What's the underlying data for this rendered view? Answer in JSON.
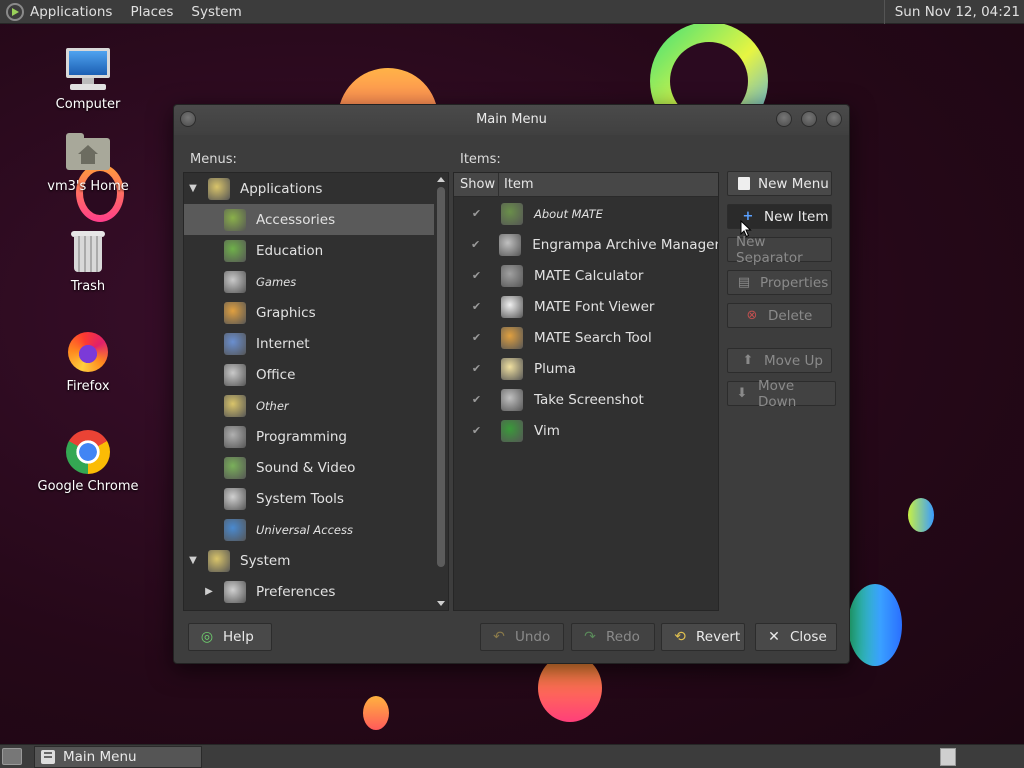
{
  "top_panel": {
    "menus": [
      "Applications",
      "Places",
      "System"
    ],
    "clock": "Sun Nov 12, 04:21"
  },
  "desktop_icons": [
    {
      "label": "Computer",
      "icon": "computer-icon"
    },
    {
      "label": "vm3's Home",
      "icon": "home-folder-icon"
    },
    {
      "label": "Trash",
      "icon": "trash-icon"
    },
    {
      "label": "Firefox",
      "icon": "firefox-icon"
    },
    {
      "label": "Google Chrome",
      "icon": "chrome-icon"
    }
  ],
  "dialog": {
    "title": "Main Menu",
    "menus_label": "Menus:",
    "items_label": "Items:",
    "tree": [
      {
        "label": "Applications",
        "icon": "applications-icon",
        "color": "#d9c46a",
        "level": 0,
        "expander": "▼",
        "italic": false
      },
      {
        "label": "Accessories",
        "icon": "accessories-icon",
        "color": "#8ab04a",
        "level": 1,
        "expander": "",
        "italic": false,
        "selected": true
      },
      {
        "label": "Education",
        "icon": "education-icon",
        "color": "#6fb04a",
        "level": 1,
        "expander": "",
        "italic": false
      },
      {
        "label": "Games",
        "icon": "games-icon",
        "color": "#c9c9c9",
        "level": 1,
        "expander": "",
        "italic": true
      },
      {
        "label": "Graphics",
        "icon": "graphics-icon",
        "color": "#e0a040",
        "level": 1,
        "expander": "",
        "italic": false
      },
      {
        "label": "Internet",
        "icon": "internet-icon",
        "color": "#6a8fd0",
        "level": 1,
        "expander": "",
        "italic": false
      },
      {
        "label": "Office",
        "icon": "office-icon",
        "color": "#c9c9c9",
        "level": 1,
        "expander": "",
        "italic": false
      },
      {
        "label": "Other",
        "icon": "other-icon",
        "color": "#d9c46a",
        "level": 1,
        "expander": "",
        "italic": true
      },
      {
        "label": "Programming",
        "icon": "programming-icon",
        "color": "#b0b0b0",
        "level": 1,
        "expander": "",
        "italic": false
      },
      {
        "label": "Sound & Video",
        "icon": "sound-video-icon",
        "color": "#7ab05a",
        "level": 1,
        "expander": "",
        "italic": false
      },
      {
        "label": "System Tools",
        "icon": "system-tools-icon",
        "color": "#d0d0d0",
        "level": 1,
        "expander": "",
        "italic": false
      },
      {
        "label": "Universal Access",
        "icon": "universal-access-icon",
        "color": "#4a8ad0",
        "level": 1,
        "expander": "",
        "italic": true
      },
      {
        "label": "System",
        "icon": "system-icon",
        "color": "#d9c46a",
        "level": 0,
        "expander": "▼",
        "italic": false
      },
      {
        "label": "Preferences",
        "icon": "preferences-icon",
        "color": "#d0d0d0",
        "level": 1,
        "expander": "▶",
        "italic": false
      }
    ],
    "items_header": {
      "show": "Show",
      "item": "Item"
    },
    "items": [
      {
        "label": "About MATE",
        "icon": "about-mate-icon",
        "color": "#6a8f4a",
        "check": "✔",
        "italic": true
      },
      {
        "label": "Engrampa Archive Manager",
        "icon": "engrampa-icon",
        "color": "#c0c0c0",
        "check": "✔",
        "italic": false
      },
      {
        "label": "MATE Calculator",
        "icon": "calculator-icon",
        "color": "#a0a0a0",
        "check": "✔",
        "italic": false
      },
      {
        "label": "MATE Font Viewer",
        "icon": "font-viewer-icon",
        "color": "#f0f0f0",
        "check": "✔",
        "italic": false
      },
      {
        "label": "MATE Search Tool",
        "icon": "search-tool-icon",
        "color": "#e0a040",
        "check": "✔",
        "italic": false
      },
      {
        "label": "Pluma",
        "icon": "pluma-icon",
        "color": "#f0e0a0",
        "check": "✔",
        "italic": false
      },
      {
        "label": "Take Screenshot",
        "icon": "screenshot-icon",
        "color": "#c0c0c0",
        "check": "✔",
        "italic": false
      },
      {
        "label": "Vim",
        "icon": "vim-icon",
        "color": "#3a9a3a",
        "check": "✔",
        "italic": false
      }
    ],
    "side_buttons": {
      "new_menu": "New Menu",
      "new_item": "New Item",
      "new_separator": "New Separator",
      "properties": "Properties",
      "delete": "Delete",
      "move_up": "Move Up",
      "move_down": "Move Down"
    },
    "bottom_buttons": {
      "help": "Help",
      "undo": "Undo",
      "redo": "Redo",
      "revert": "Revert",
      "close": "Close"
    }
  },
  "taskbar": {
    "task": "Main Menu"
  }
}
